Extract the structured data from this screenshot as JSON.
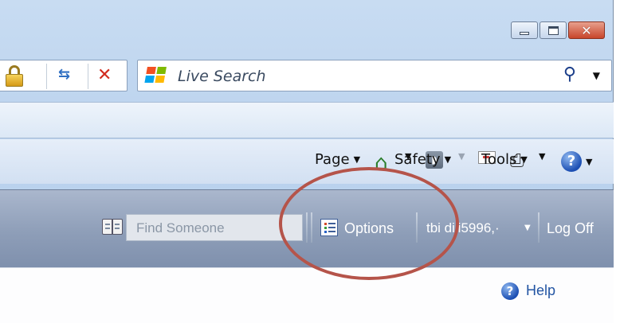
{
  "browser": {
    "search": {
      "placeholder": "Live Search"
    },
    "command_bar": {
      "page_label": "Page",
      "safety_label": "Safety",
      "tools_label": "Tools"
    }
  },
  "app_toolbar": {
    "find_placeholder": "Find Someone",
    "options_label": "Options",
    "user_label": "tbi diii5996,·",
    "logoff_label": "Log Off"
  },
  "content": {
    "help_label": "Help"
  },
  "icons": {
    "window_controls": [
      "minimize-icon",
      "maximize-icon",
      "close-icon"
    ],
    "address": [
      "lock-icon",
      "refresh-icon",
      "stop-icon"
    ],
    "command": [
      "home-icon",
      "rss-feeds-icon",
      "read-mail-icon",
      "print-icon",
      "help-icon"
    ]
  },
  "colors": {
    "annotation_circle": "#b5544a",
    "close_button": "#c8452b",
    "link": "#2355a3"
  }
}
